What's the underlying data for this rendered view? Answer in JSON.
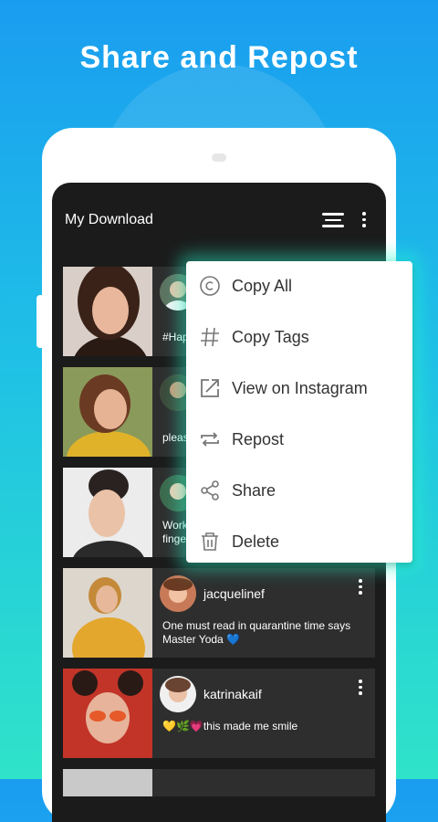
{
  "headline": "Share and Repost",
  "appbar": {
    "title": "My Download",
    "filter_icon": "filter-lines-icon",
    "more_icon": "more-vertical-icon"
  },
  "colors": {
    "background_top": "#1a9df0",
    "background_bottom": "#2fe3c9",
    "screen": "#1b1b1b",
    "card": "#2e2e2e",
    "menu_glow": "#28ffd2"
  },
  "posts": [
    {
      "username": "",
      "caption": "#Hap"
    },
    {
      "username": "",
      "caption": "pleas"
    },
    {
      "username": "",
      "caption": "Work fingers"
    },
    {
      "username": "jacquelinef",
      "caption": "One must read in quarantine time says Master Yoda 💙"
    },
    {
      "username": "katrinakaif",
      "caption": "💛🌿💗this made me smile"
    }
  ],
  "context_menu": {
    "items": [
      {
        "label": "Copy All",
        "icon": "copyright-icon"
      },
      {
        "label": "Copy Tags",
        "icon": "hashtag-icon"
      },
      {
        "label": "View on Instagram",
        "icon": "open-external-icon"
      },
      {
        "label": "Repost",
        "icon": "repost-icon"
      },
      {
        "label": "Share",
        "icon": "share-icon"
      },
      {
        "label": "Delete",
        "icon": "trash-icon"
      }
    ]
  }
}
